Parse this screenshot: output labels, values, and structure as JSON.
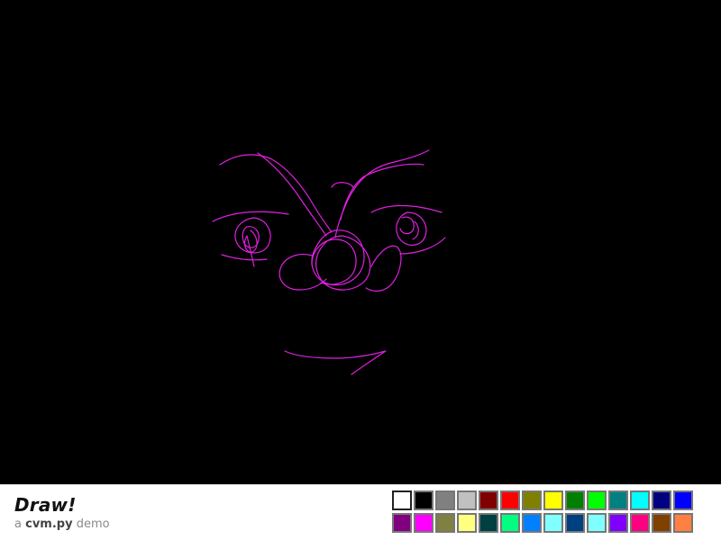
{
  "app": {
    "title": "Draw!",
    "subtitle_prefix": "a",
    "subtitle_name": "cvm.py",
    "subtitle_suffix": "demo"
  },
  "canvas": {
    "background": "#000000",
    "stroke_color": "#e020e0"
  },
  "palette": {
    "selected_index": 0,
    "colors": [
      "#ffffff",
      "#000000",
      "#808080",
      "#c0c0c0",
      "#800000",
      "#ff0000",
      "#808000",
      "#ffff00",
      "#008000",
      "#00ff00",
      "#008080",
      "#00ffff",
      "#000080",
      "#0000ff",
      "#800080",
      "#ff00ff",
      "#808040",
      "#ffff80",
      "#004040",
      "#00ff80",
      "#0080ff",
      "#80ffff",
      "#004080",
      "#80ffff",
      "#8000ff",
      "#ff0080",
      "#804000",
      "#ff8040"
    ]
  }
}
